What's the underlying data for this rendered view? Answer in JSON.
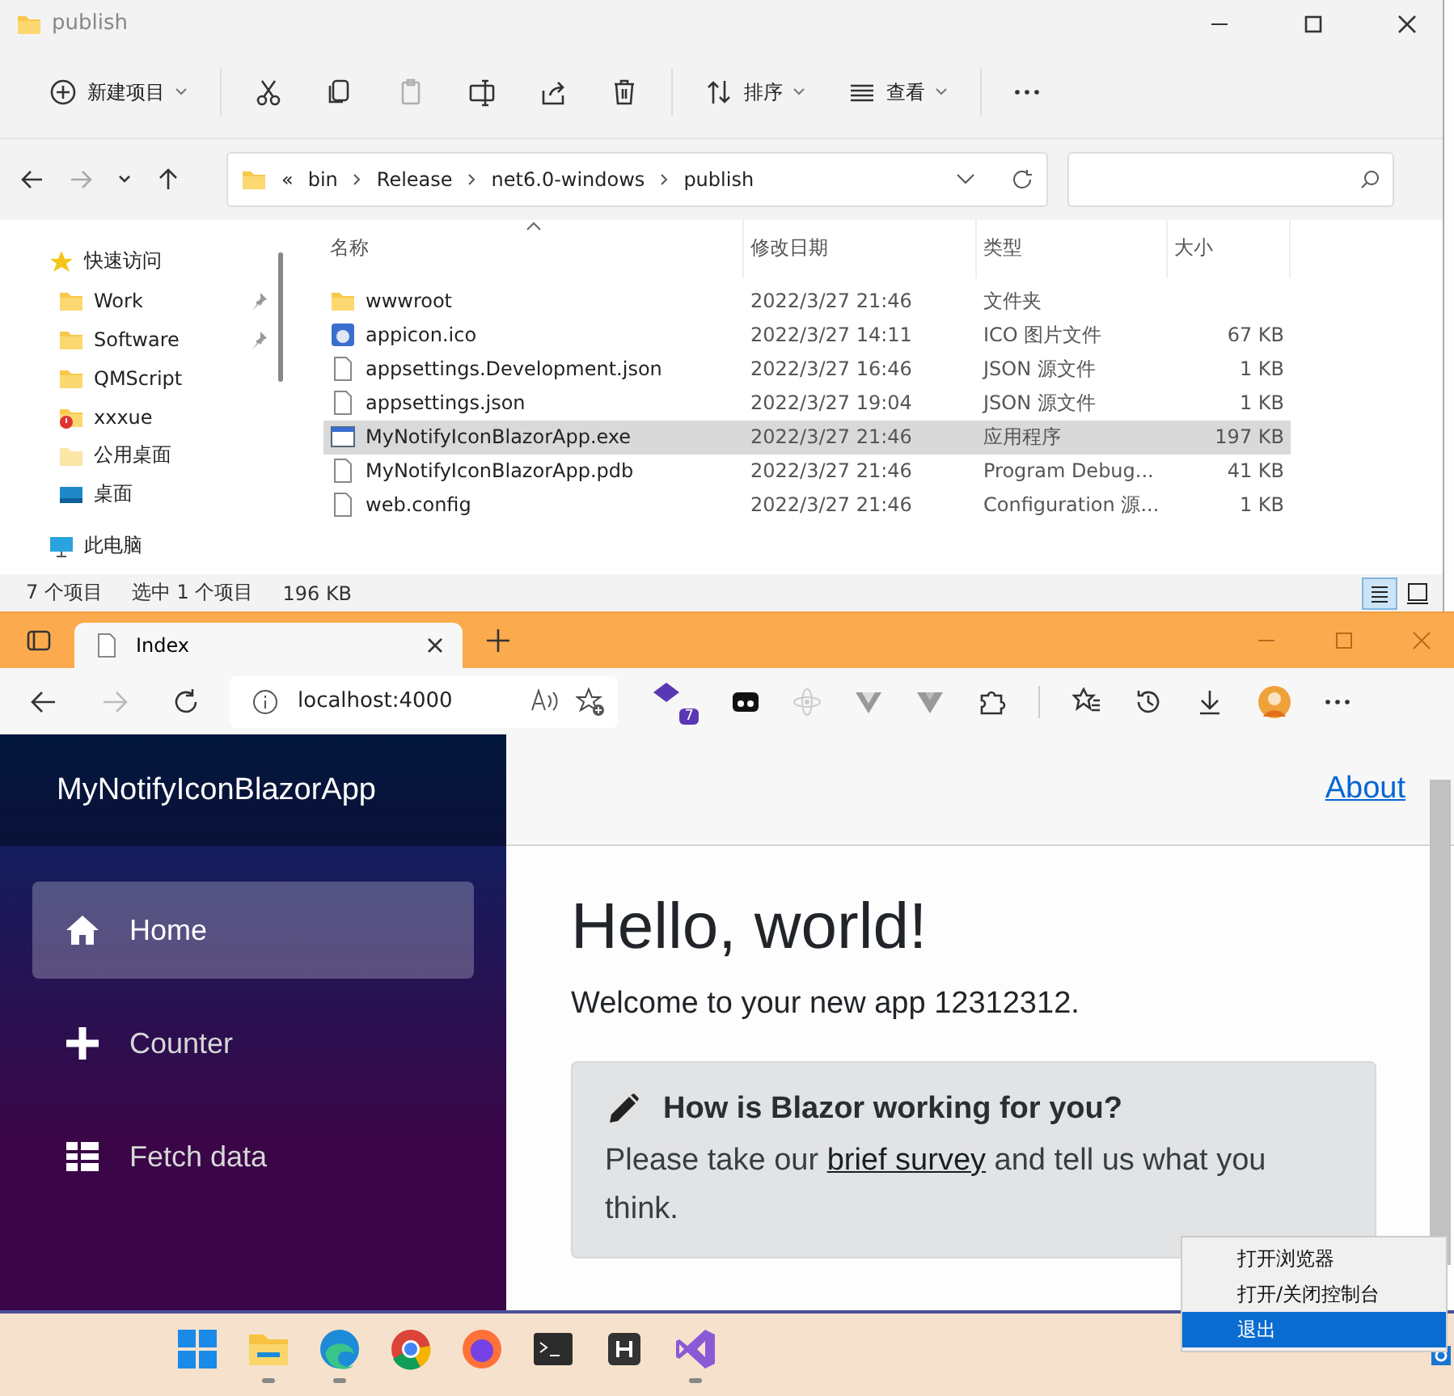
{
  "explorer": {
    "window": {
      "title": "publish"
    },
    "toolbar": [
      {
        "kind": "new",
        "label": "新建项目",
        "disabled": false
      },
      {
        "kind": "cut",
        "disabled": false
      },
      {
        "kind": "copy",
        "disabled": false
      },
      {
        "kind": "paste",
        "disabled": true
      },
      {
        "kind": "rename",
        "disabled": false
      },
      {
        "kind": "share",
        "disabled": false
      },
      {
        "kind": "delete",
        "disabled": false
      },
      {
        "kind": "sort",
        "label": "排序",
        "disabled": false
      },
      {
        "kind": "view",
        "label": "查看",
        "disabled": false
      },
      {
        "kind": "more",
        "disabled": false
      }
    ],
    "breadcrumb": [
      "«",
      "bin",
      "Release",
      "net6.0-windows",
      "publish"
    ],
    "sidebar": {
      "items": [
        {
          "kind": "star",
          "label": "快速访问",
          "children": [
            {
              "kind": "folder",
              "label": "Work",
              "pinned": true
            },
            {
              "kind": "folder",
              "label": "Software",
              "pinned": true
            },
            {
              "kind": "folder",
              "label": "QMScript",
              "pinned": false
            },
            {
              "kind": "folder-alert",
              "label": "xxxue",
              "pinned": false
            },
            {
              "kind": "folder-light",
              "label": "公用桌面",
              "pinned": false
            },
            {
              "kind": "desktop",
              "label": "桌面",
              "pinned": false
            }
          ]
        },
        {
          "kind": "pc",
          "label": "此电脑"
        }
      ]
    },
    "table": {
      "columns": [
        {
          "label": "名称",
          "sorted": true
        },
        {
          "label": "修改日期",
          "sorted": false
        },
        {
          "label": "类型",
          "sorted": false
        },
        {
          "label": "大小",
          "sorted": false
        }
      ],
      "rows": [
        {
          "kind": "folder",
          "name": "wwwroot",
          "date": "2022/3/27 21:46",
          "type": "文件夹",
          "size": "",
          "selected": false
        },
        {
          "kind": "ico",
          "name": "appicon.ico",
          "date": "2022/3/27 14:11",
          "type": "ICO 图片文件",
          "size": "67 KB",
          "selected": false
        },
        {
          "kind": "doc",
          "name": "appsettings.Development.json",
          "date": "2022/3/27 16:46",
          "type": "JSON 源文件",
          "size": "1 KB",
          "selected": false
        },
        {
          "kind": "doc",
          "name": "appsettings.json",
          "date": "2022/3/27 19:04",
          "type": "JSON 源文件",
          "size": "1 KB",
          "selected": false
        },
        {
          "kind": "exe",
          "name": "MyNotifyIconBlazorApp.exe",
          "date": "2022/3/27 21:46",
          "type": "应用程序",
          "size": "197 KB",
          "selected": true
        },
        {
          "kind": "doc",
          "name": "MyNotifyIconBlazorApp.pdb",
          "date": "2022/3/27 21:46",
          "type": "Program Debug...",
          "size": "41 KB",
          "selected": false
        },
        {
          "kind": "doc",
          "name": "web.config",
          "date": "2022/3/27 21:46",
          "type": "Configuration 源...",
          "size": "1 KB",
          "selected": false
        }
      ]
    },
    "status_bar": [
      "7 个项目",
      "选中 1 个项目",
      "196 KB"
    ],
    "views": [
      {
        "kind": "details",
        "selected": true
      },
      {
        "kind": "tiles",
        "selected": false
      }
    ]
  },
  "browser": {
    "tab": {
      "title": "Index"
    },
    "address": "localhost:4000",
    "extension_badge": "7",
    "app": {
      "brand": "MyNotifyIconBlazorApp",
      "nav": [
        {
          "kind": "home",
          "label": "Home",
          "selected": true
        },
        {
          "kind": "plus",
          "label": "Counter",
          "selected": false
        },
        {
          "kind": "list",
          "label": "Fetch data",
          "selected": false
        }
      ],
      "top_link": "About",
      "heading": "Hello, world!",
      "welcome": "Welcome to your new app 12312312.",
      "survey": {
        "title": "How is Blazor working for you?",
        "before": "Please take our",
        "link": "brief survey",
        "after": "and tell us what you think."
      }
    }
  },
  "context_menu": [
    {
      "label": "打开浏览器",
      "selected": false
    },
    {
      "label": "打开/关闭控制台",
      "selected": false
    },
    {
      "label": "退出",
      "selected": true
    }
  ],
  "taskbar": [
    {
      "kind": "start",
      "running": false
    },
    {
      "kind": "explorer",
      "running": true
    },
    {
      "kind": "edge",
      "running": true
    },
    {
      "kind": "chrome",
      "running": false
    },
    {
      "kind": "firefox",
      "running": false
    },
    {
      "kind": "terminal",
      "running": false
    },
    {
      "kind": "h",
      "running": false
    },
    {
      "kind": "vs",
      "running": true
    }
  ]
}
